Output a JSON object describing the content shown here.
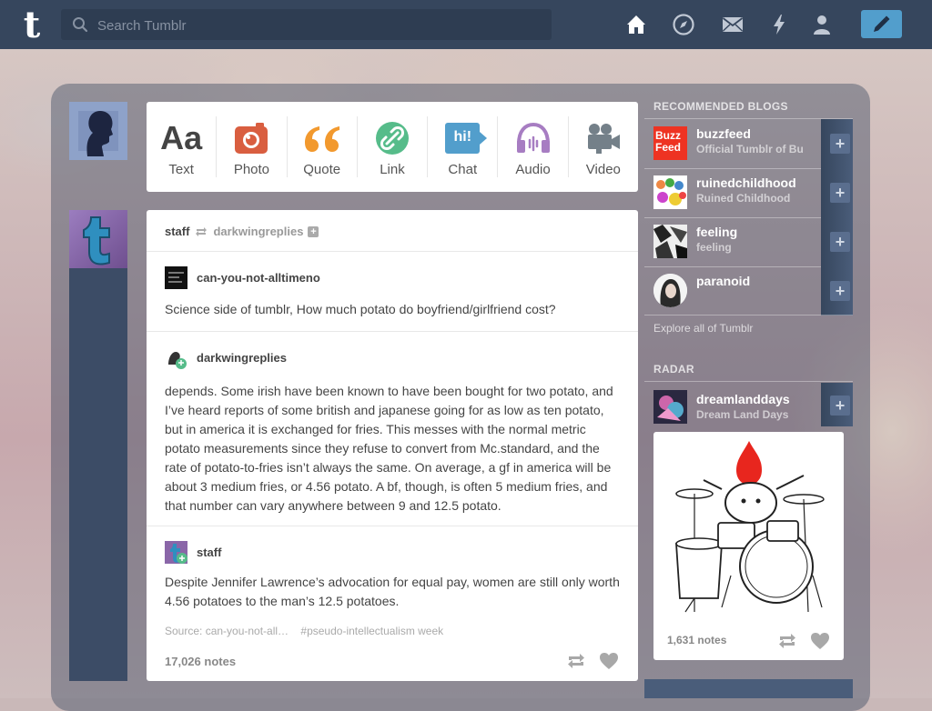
{
  "topbar": {
    "logo": "t",
    "search_placeholder": "Search Tumblr",
    "icons": [
      "home-icon",
      "compass-icon",
      "mail-icon",
      "lightning-icon",
      "account-icon",
      "compose-pencil-icon"
    ]
  },
  "newpost": {
    "items": [
      {
        "label": "Text",
        "icon": "Aa"
      },
      {
        "label": "Photo",
        "icon": "camera"
      },
      {
        "label": "Quote",
        "icon": "quote"
      },
      {
        "label": "Link",
        "icon": "link"
      },
      {
        "label": "Chat",
        "icon": "hi!"
      },
      {
        "label": "Audio",
        "icon": "headphones"
      },
      {
        "label": "Video",
        "icon": "video-camera"
      }
    ]
  },
  "post": {
    "author": "staff",
    "reblogged_from": "darkwingreplies",
    "trail": [
      {
        "name": "can-you-not-alltimeno",
        "body": "Science side of tumblr, How much potato do boyfriend/girlfriend cost?"
      },
      {
        "name": "darkwingreplies",
        "body": "depends. Some irish have been known to have been bought for two potato, and I’ve heard reports of some british and japanese going for as low as ten potato, but in america it is exchanged for fries. This messes with the normal metric potato measurements since they refuse to convert from Mc.standard, and the rate of potato-to-fries isn’t always the same. On average, a gf in america will be about 3 medium fries, or 4.56 potato. A bf, though, is often 5 medium fries, and that number can vary anywhere between 9 and 12.5 potato."
      },
      {
        "name": "staff",
        "body": "Despite Jennifer Lawrence’s advocation for equal pay, women are still only worth 4.56 potatoes to the man’s 12.5 potatoes."
      }
    ],
    "source": "Source: can-you-not-all…",
    "tag": "#pseudo-intellectualism week",
    "notes": "17,026 notes"
  },
  "sidebar": {
    "recommended_title": "RECOMMENDED BLOGS",
    "blogs": [
      {
        "name": "buzzfeed",
        "subtitle": "Official Tumblr of Bu",
        "avatar_text": "Buzz Feed"
      },
      {
        "name": "ruinedchildhood",
        "subtitle": "Ruined Childhood",
        "avatar_text": ""
      },
      {
        "name": "feeling",
        "subtitle": "feeling",
        "avatar_text": ""
      },
      {
        "name": "paranoid",
        "subtitle": "",
        "avatar_text": ""
      }
    ],
    "explore": "Explore all of Tumblr",
    "radar_title": "RADAR",
    "radar_blog": {
      "name": "dreamlanddays",
      "subtitle": "Dream Land Days"
    },
    "radar_notes": "1,631 notes"
  },
  "colors": {
    "topbar": "#36465d",
    "accent": "#529ecc",
    "photo": "#d95e40",
    "quote": "#f2992e",
    "link": "#56bc8a",
    "chat": "#529ecc",
    "audio": "#a77dc2",
    "video": "#748089"
  }
}
